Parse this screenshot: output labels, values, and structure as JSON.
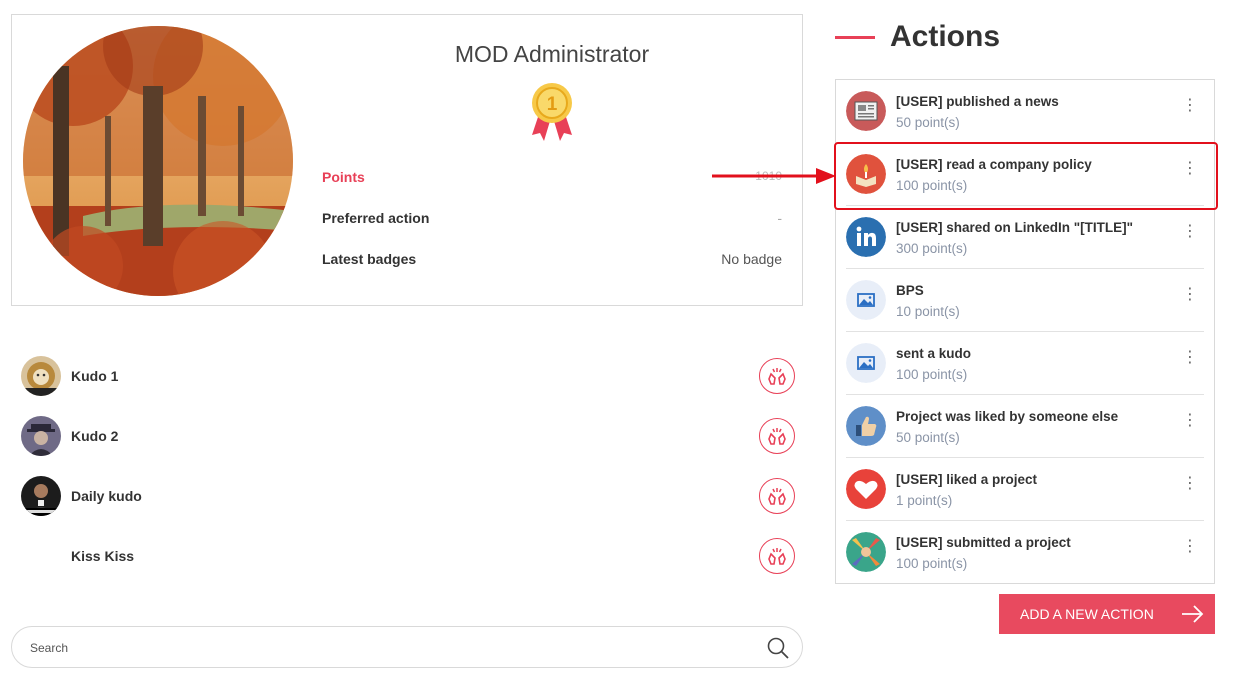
{
  "profile": {
    "name": "MOD Administrator",
    "badge_rank": "1",
    "stats": [
      {
        "label": "Points",
        "value": "1010"
      },
      {
        "label": "Preferred action",
        "value": "-"
      },
      {
        "label": "Latest badges",
        "value": "No badge"
      }
    ]
  },
  "kudos": [
    {
      "name": "Kudo 1",
      "avatar": "lion-avatar"
    },
    {
      "name": "Kudo 2",
      "avatar": "person-hat-avatar"
    },
    {
      "name": "Daily kudo",
      "avatar": "good-job-avatar"
    },
    {
      "name": "Kiss Kiss",
      "avatar": ""
    }
  ],
  "search": {
    "placeholder": "Search"
  },
  "actions": {
    "title": "Actions",
    "items": [
      {
        "title": "[USER] published a news",
        "points": "50 point(s)",
        "icon": "newspaper-icon"
      },
      {
        "title": "[USER] read a company policy",
        "points": "100 point(s)",
        "icon": "policy-book-icon"
      },
      {
        "title": "[USER] shared on LinkedIn \"[TITLE]\"",
        "points": "300 point(s)",
        "icon": "linkedin-icon"
      },
      {
        "title": "BPS",
        "points": "10 point(s)",
        "icon": "image-icon"
      },
      {
        "title": "sent a kudo",
        "points": "100 point(s)",
        "icon": "image-icon"
      },
      {
        "title": "Project was liked by someone else",
        "points": "50 point(s)",
        "icon": "thumbs-up-icon"
      },
      {
        "title": "[USER] liked a project",
        "points": "1 point(s)",
        "icon": "heart-icon"
      },
      {
        "title": "[USER] submitted a project",
        "points": "100 point(s)",
        "icon": "team-hands-icon"
      }
    ],
    "menu_glyph": "⋮",
    "add_button": "ADD A NEW ACTION"
  },
  "colors": {
    "accent": "#e84057",
    "button": "#e84a5f",
    "highlight": "#e2101c",
    "muted_text": "#8a94a6"
  }
}
